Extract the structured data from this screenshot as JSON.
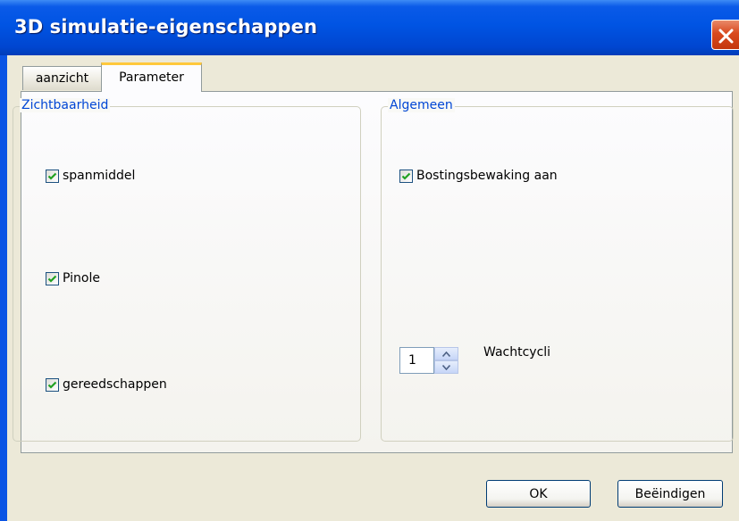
{
  "window": {
    "title": "3D simulatie-eigenschappen"
  },
  "tabs": [
    {
      "label": "aanzicht",
      "active": false
    },
    {
      "label": "Parameter",
      "active": true
    }
  ],
  "visibility_group": {
    "legend": "Zichtbaarheid",
    "items": [
      {
        "label": "spanmiddel",
        "checked": true
      },
      {
        "label": "Pinole",
        "checked": true
      },
      {
        "label": "gereedschappen",
        "checked": true
      }
    ]
  },
  "general_group": {
    "legend": "Algemeen",
    "collision_label": "Bostingsbewaking aan",
    "collision_checked": true,
    "wait_value": "1",
    "wait_label": "Wachtcycli"
  },
  "buttons": {
    "ok": "OK",
    "exit": "Beëindigen"
  },
  "colors": {
    "title_bar": "#0054e3",
    "close": "#d9491e",
    "legend_text": "#0046d5",
    "active_tab_accent": "#ffc83c",
    "check_mark": "#21a121",
    "dialog_bg": "#ece9d8"
  }
}
